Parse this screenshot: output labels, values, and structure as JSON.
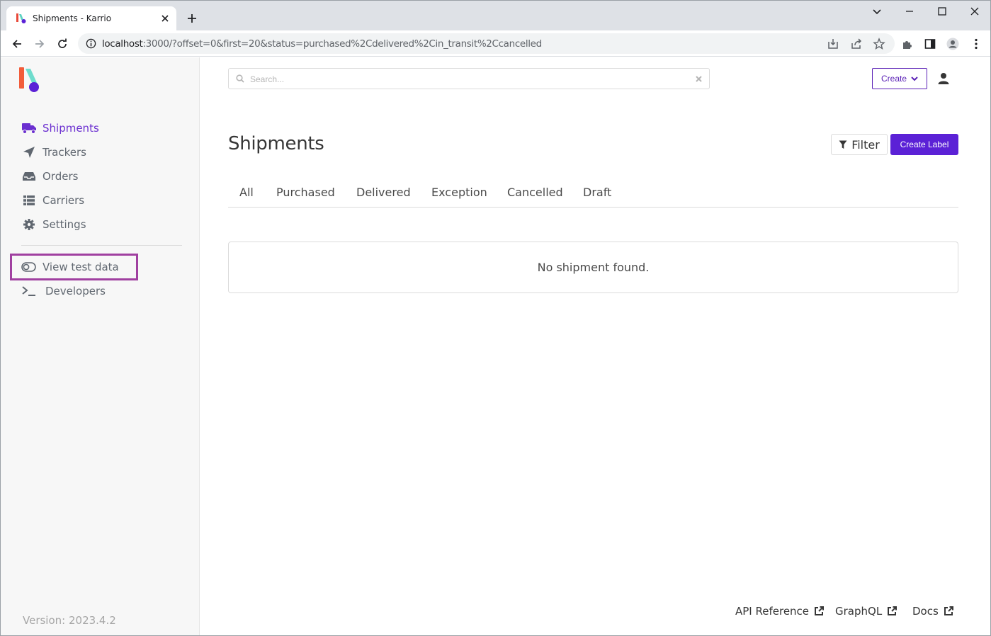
{
  "browser": {
    "tab_title": "Shipments - Karrio",
    "url_host": "localhost",
    "url_rest": ":3000/?offset=0&first=20&status=purchased%2Cdelivered%2Cin_transit%2Ccancelled"
  },
  "sidebar": {
    "items": [
      {
        "label": "Shipments",
        "icon": "truck-icon",
        "active": true
      },
      {
        "label": "Trackers",
        "icon": "location-arrow-icon"
      },
      {
        "label": "Orders",
        "icon": "inbox-icon"
      },
      {
        "label": "Carriers",
        "icon": "list-icon"
      },
      {
        "label": "Settings",
        "icon": "gear-icon"
      }
    ],
    "test_toggle_label": "View test data",
    "developers_label": "Developers",
    "version": "Version: 2023.4.2"
  },
  "header": {
    "search_placeholder": "Search...",
    "create_label": "Create"
  },
  "page": {
    "title": "Shipments",
    "filter_label": "Filter",
    "create_label_button": "Create Label",
    "tabs": [
      "All",
      "Purchased",
      "Delivered",
      "Exception",
      "Cancelled",
      "Draft"
    ],
    "empty_message": "No shipment found."
  },
  "footer": {
    "links": [
      "API Reference",
      "GraphQL",
      "Docs"
    ]
  },
  "colors": {
    "accent": "#5b21d6",
    "active_nav": "#6b2fd0",
    "highlight_border": "#a040a0"
  }
}
